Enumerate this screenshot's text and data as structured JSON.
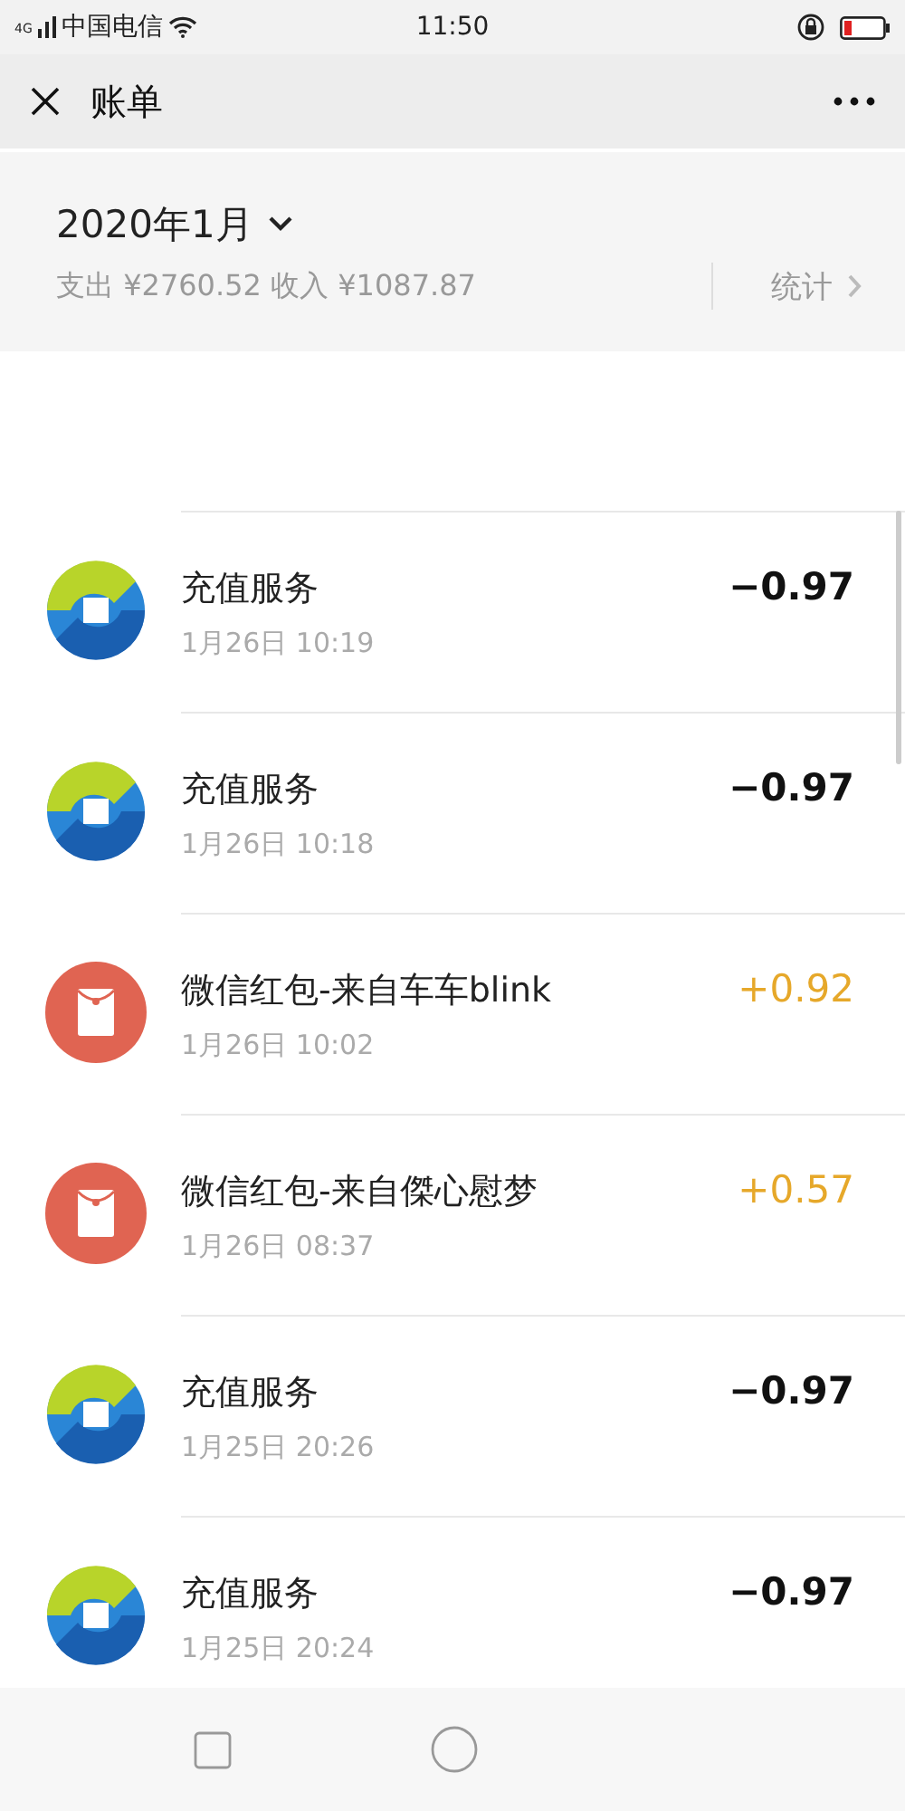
{
  "status_bar": {
    "network": "4G",
    "carrier": "中国电信",
    "time": "11:50"
  },
  "header": {
    "title": "账单"
  },
  "summary": {
    "month": "2020年1月",
    "totals": "支出 ¥2760.52 收入 ¥1087.87",
    "stats_link": "统计"
  },
  "transactions": [
    {
      "kind": "recharge",
      "title": "充值服务",
      "time": "1月26日 10:19",
      "amount": "−0.97",
      "color": "#111111"
    },
    {
      "kind": "recharge",
      "title": "充值服务",
      "time": "1月26日 10:18",
      "amount": "−0.97",
      "color": "#111111"
    },
    {
      "kind": "red_packet",
      "title": "微信红包-来自车车blink",
      "time": "1月26日 10:02",
      "amount": "+0.92",
      "color": "#e6a82a"
    },
    {
      "kind": "red_packet",
      "title": "微信红包-来自傑心慰梦",
      "time": "1月26日 08:37",
      "amount": "+0.57",
      "color": "#e6a82a"
    },
    {
      "kind": "recharge",
      "title": "充值服务",
      "time": "1月25日 20:26",
      "amount": "−0.97",
      "color": "#111111"
    },
    {
      "kind": "recharge",
      "title": "充值服务",
      "time": "1月25日 20:24",
      "amount": "−0.97",
      "color": "#111111"
    }
  ]
}
